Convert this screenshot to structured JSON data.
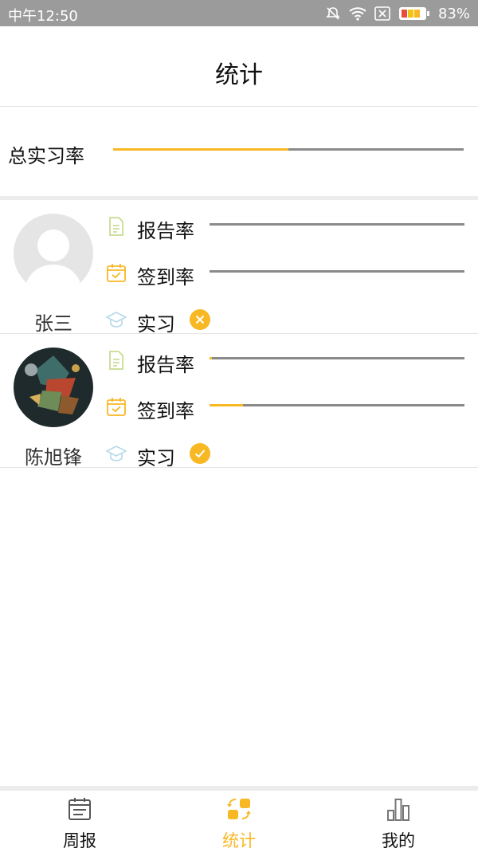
{
  "status_bar": {
    "time": "中午12:50",
    "battery": "83%"
  },
  "header": {
    "title": "统计"
  },
  "total": {
    "label": "总实习率",
    "progress": 0.5
  },
  "students": [
    {
      "name": "张三",
      "report_label": "报告率",
      "report_progress": 0.0,
      "signin_label": "签到率",
      "signin_progress": 0.0,
      "intern_label": "实习",
      "intern_status": "not-interning"
    },
    {
      "name": "陈旭锋",
      "report_label": "报告率",
      "report_progress": 0.01,
      "signin_label": "签到率",
      "signin_progress": 0.13,
      "intern_label": "实习",
      "intern_status": "interning"
    }
  ],
  "nav": {
    "items": [
      {
        "label": "周报",
        "icon": "calendar-icon"
      },
      {
        "label": "统计",
        "icon": "stats-swap-icon",
        "active": true
      },
      {
        "label": "我的",
        "icon": "bar-chart-icon"
      }
    ]
  },
  "colors": {
    "accent": "#f7b823",
    "track": "#8a8a8a",
    "statusbar": "#9b9b9b"
  }
}
